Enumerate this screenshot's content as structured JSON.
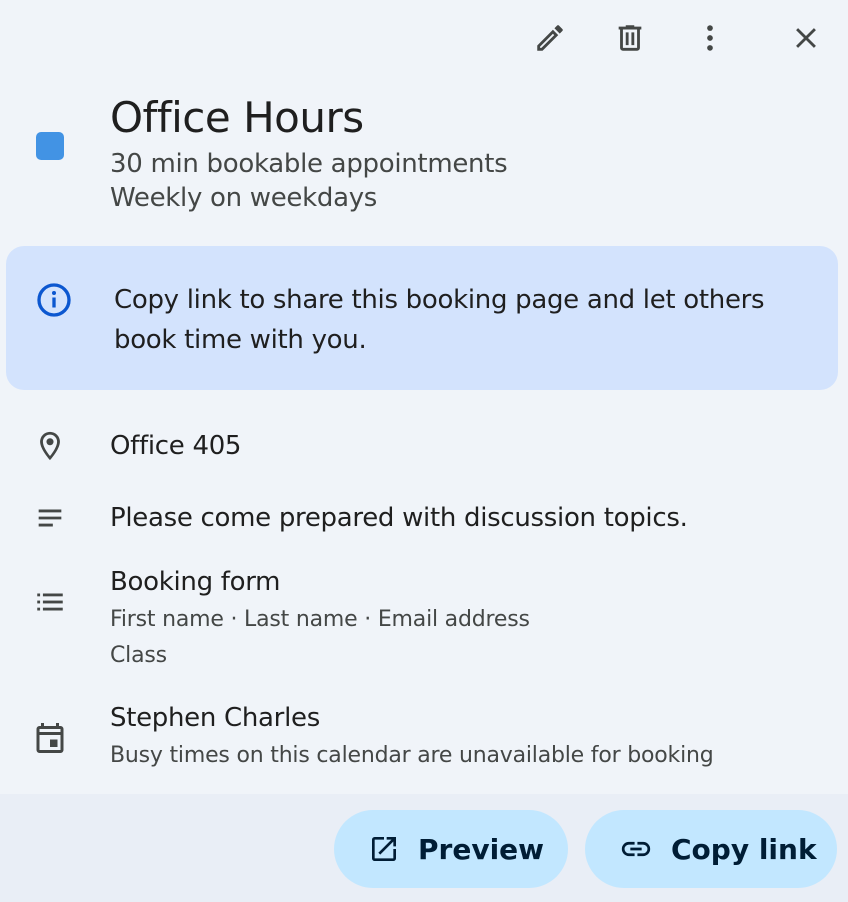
{
  "toolbar": {
    "edit_icon": "pencil-icon",
    "delete_icon": "trash-icon",
    "more_icon": "more-vert-icon",
    "close_icon": "close-icon"
  },
  "event": {
    "color": "#4293e4",
    "title": "Office Hours",
    "duration_text": "30 min bookable appointments",
    "recurrence_text": "Weekly on weekdays"
  },
  "info": {
    "text": "Copy link to share this booking page and let others book time with you."
  },
  "details": {
    "location": "Office 405",
    "description": "Please come prepared with discussion topics.",
    "booking_form": {
      "label": "Booking form",
      "fields": "First name · Last name · Email address",
      "extra": "Class"
    },
    "calendar": {
      "owner": "Stephen Charles",
      "note": "Busy times on this calendar are unavailable for booking"
    }
  },
  "footer": {
    "preview_label": "Preview",
    "copy_link_label": "Copy link"
  }
}
